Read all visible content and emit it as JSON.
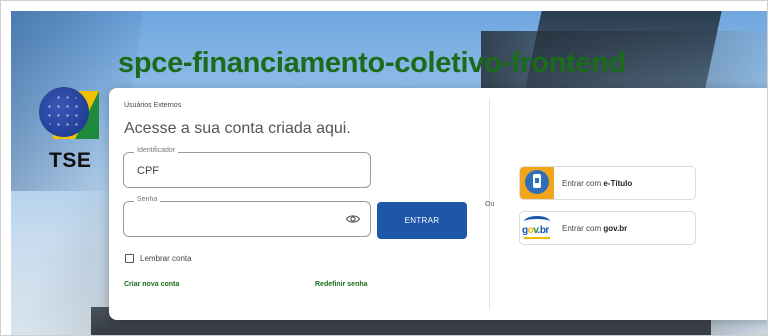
{
  "app": {
    "title": "spce-financiamento-coletivo-frontend",
    "logo_text": "TSE"
  },
  "login": {
    "small_label": "Usuários Externos",
    "heading": "Acesse a sua conta criada aqui.",
    "identifier": {
      "legend": "Identificador",
      "value": "CPF"
    },
    "password": {
      "legend": "Senha",
      "value": ""
    },
    "submit_label": "ENTRAR",
    "remember_label": "Lembrar conta",
    "create_account_label": "Criar nova conta",
    "reset_password_label": "Redefinir senha"
  },
  "divider_text": "Ou",
  "external": {
    "etitulo": {
      "prefix": "Entrar com ",
      "name": "e-Título",
      "icon": "e-titulo-icon"
    },
    "govbr": {
      "prefix": "Entrar com ",
      "name": "gov.br",
      "icon": "govbr-icon"
    }
  },
  "colors": {
    "title_green": "#1a6b1a",
    "button_blue": "#1e56a8",
    "link_green": "#1a6b1a"
  }
}
